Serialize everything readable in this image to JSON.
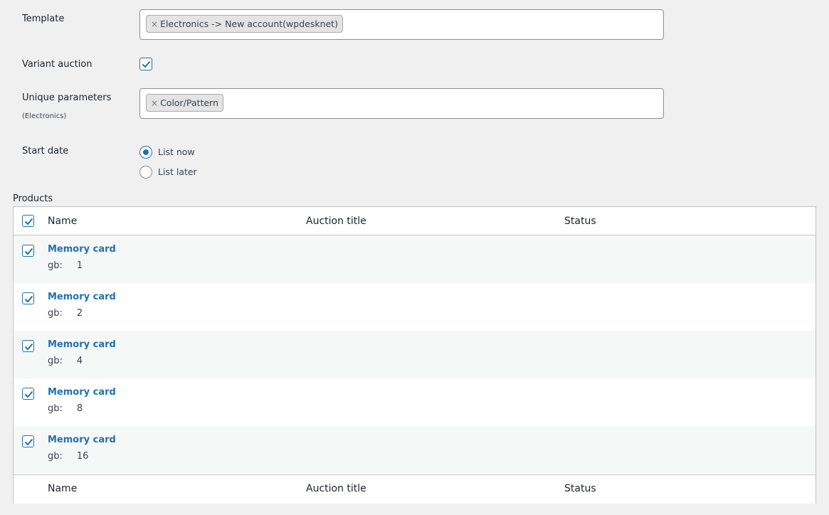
{
  "form": {
    "template_label": "Template",
    "template_chip": "Electronics -> New account(wpdesknet)",
    "variant_label": "Variant auction",
    "variant_checked": true,
    "unique_label": "Unique parameters",
    "unique_sublabel": "(Electronics)",
    "unique_chip": "Color/Pattern",
    "start_label": "Start date",
    "start_options": [
      {
        "label": "List now",
        "selected": true
      },
      {
        "label": "List later",
        "selected": false
      }
    ],
    "chip_remove": "×"
  },
  "products": {
    "title": "Products",
    "columns": [
      "Name",
      "Auction title",
      "Status"
    ],
    "rows": [
      {
        "name": "Memory card",
        "attr": "gb:",
        "value": "1"
      },
      {
        "name": "Memory card",
        "attr": "gb:",
        "value": "2"
      },
      {
        "name": "Memory card",
        "attr": "gb:",
        "value": "4"
      },
      {
        "name": "Memory card",
        "attr": "gb:",
        "value": "8"
      },
      {
        "name": "Memory card",
        "attr": "gb:",
        "value": "16"
      }
    ]
  },
  "colors": {
    "accent": "#2271b1",
    "background": "#f0f0f1",
    "row_alt": "#f6f7f7"
  }
}
